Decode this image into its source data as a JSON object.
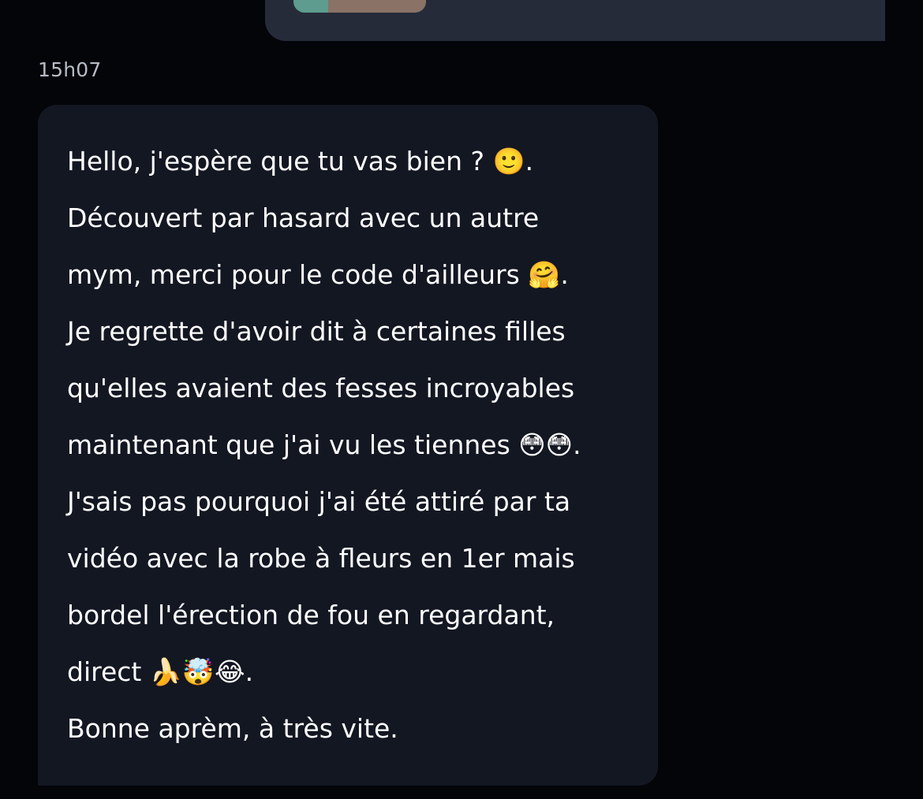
{
  "conversation": {
    "previous_message": {
      "type": "image"
    },
    "timestamp": "15h07",
    "message": {
      "lines": [
        "Hello, j'espère que tu vas bien ? 🙂.",
        "Découvert par hasard avec un autre",
        "mym, merci pour le code d'ailleurs 🤗.",
        "Je regrette d'avoir dit à certaines filles",
        "qu'elles avaient des fesses incroyables",
        "maintenant que j'ai vu les tiennes 😳😳.",
        "J'sais pas pourquoi j'ai été attiré par ta",
        "vidéo avec la robe à fleurs en 1er mais",
        "bordel l'érection de fou en regardant,",
        "direct 🍌🤯😂.",
        "Bonne aprèm, à très vite."
      ]
    }
  }
}
